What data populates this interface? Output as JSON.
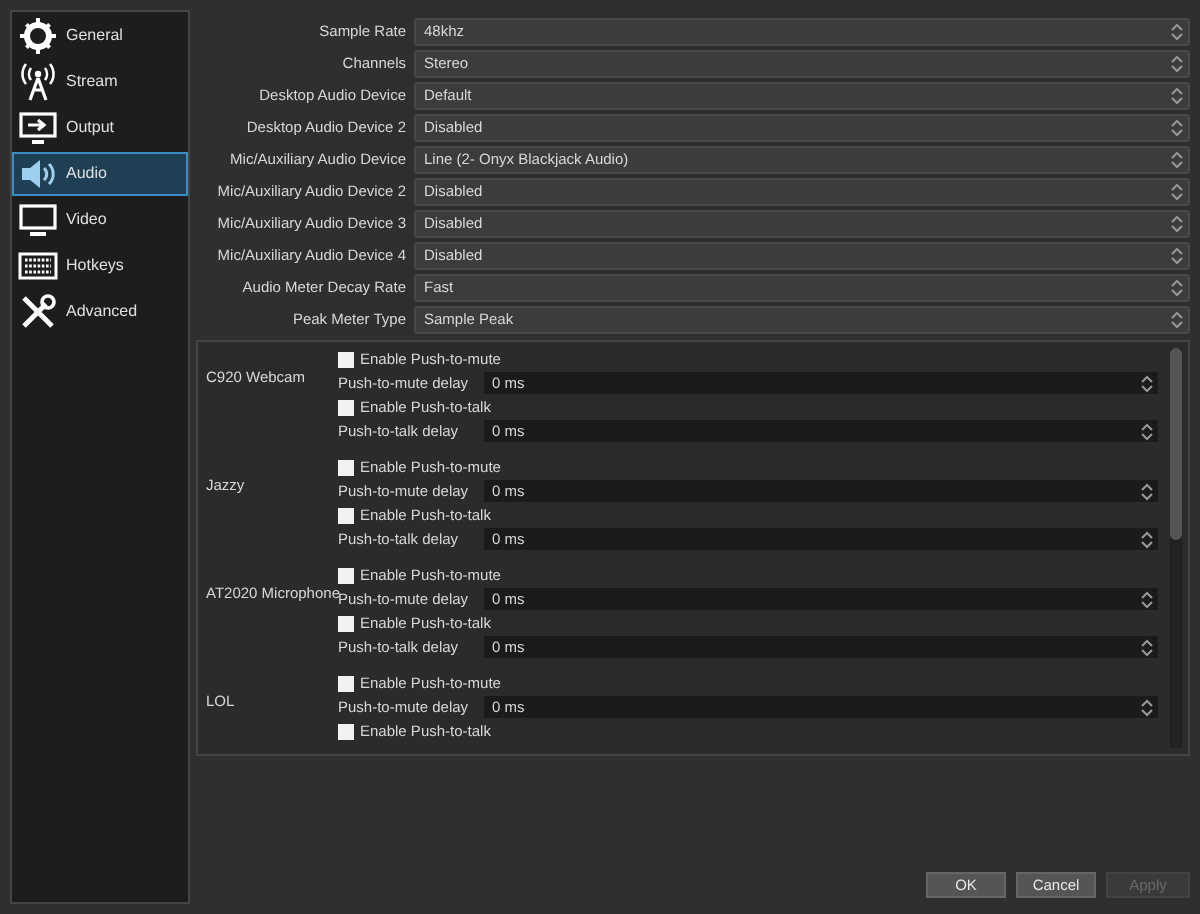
{
  "sidebar": {
    "items": [
      {
        "label": "General",
        "selected": false
      },
      {
        "label": "Stream",
        "selected": false
      },
      {
        "label": "Output",
        "selected": false
      },
      {
        "label": "Audio",
        "selected": true
      },
      {
        "label": "Video",
        "selected": false
      },
      {
        "label": "Hotkeys",
        "selected": false
      },
      {
        "label": "Advanced",
        "selected": false
      }
    ]
  },
  "settings": [
    {
      "label": "Sample Rate",
      "value": "48khz"
    },
    {
      "label": "Channels",
      "value": "Stereo"
    },
    {
      "label": "Desktop Audio Device",
      "value": "Default"
    },
    {
      "label": "Desktop Audio Device 2",
      "value": "Disabled"
    },
    {
      "label": "Mic/Auxiliary Audio Device",
      "value": "Line (2- Onyx Blackjack Audio)"
    },
    {
      "label": "Mic/Auxiliary Audio Device 2",
      "value": "Disabled"
    },
    {
      "label": "Mic/Auxiliary Audio Device 3",
      "value": "Disabled"
    },
    {
      "label": "Mic/Auxiliary Audio Device 4",
      "value": "Disabled"
    },
    {
      "label": "Audio Meter Decay Rate",
      "value": "Fast"
    },
    {
      "label": "Peak Meter Type",
      "value": "Sample Peak"
    }
  ],
  "devices": [
    {
      "name": "C920 Webcam",
      "rows": [
        {
          "kind": "checkbox",
          "label": "Enable Push-to-mute",
          "checked": false
        },
        {
          "kind": "delay",
          "label": "Push-to-mute delay",
          "value": "0 ms"
        },
        {
          "kind": "checkbox",
          "label": "Enable Push-to-talk",
          "checked": false
        },
        {
          "kind": "delay",
          "label": "Push-to-talk delay",
          "value": "0 ms"
        }
      ]
    },
    {
      "name": "Jazzy",
      "rows": [
        {
          "kind": "checkbox",
          "label": "Enable Push-to-mute",
          "checked": false
        },
        {
          "kind": "delay",
          "label": "Push-to-mute delay",
          "value": "0 ms"
        },
        {
          "kind": "checkbox",
          "label": "Enable Push-to-talk",
          "checked": false
        },
        {
          "kind": "delay",
          "label": "Push-to-talk delay",
          "value": "0 ms"
        }
      ]
    },
    {
      "name": "AT2020 Microphone",
      "rows": [
        {
          "kind": "checkbox",
          "label": "Enable Push-to-mute",
          "checked": false
        },
        {
          "kind": "delay",
          "label": "Push-to-mute delay",
          "value": "0 ms"
        },
        {
          "kind": "checkbox",
          "label": "Enable Push-to-talk",
          "checked": false
        },
        {
          "kind": "delay",
          "label": "Push-to-talk delay",
          "value": "0 ms"
        }
      ]
    },
    {
      "name": "LOL",
      "rows": [
        {
          "kind": "checkbox",
          "label": "Enable Push-to-mute",
          "checked": false
        },
        {
          "kind": "delay",
          "label": "Push-to-mute delay",
          "value": "0 ms"
        },
        {
          "kind": "checkbox",
          "label": "Enable Push-to-talk",
          "checked": false
        }
      ]
    }
  ],
  "buttons": [
    {
      "label": "OK",
      "disabled": false
    },
    {
      "label": "Cancel",
      "disabled": false
    },
    {
      "label": "Apply",
      "disabled": true
    }
  ]
}
